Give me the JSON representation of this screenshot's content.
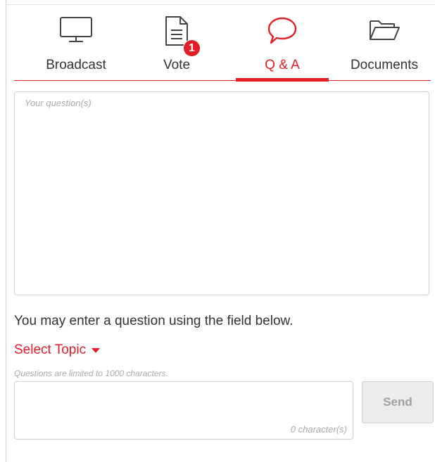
{
  "tabs": [
    {
      "label": "Broadcast",
      "icon": "monitor-icon",
      "active": false
    },
    {
      "label": "Vote",
      "icon": "document-icon",
      "active": false,
      "badge": "1"
    },
    {
      "label": "Q & A",
      "icon": "speech-bubble-icon",
      "active": true
    },
    {
      "label": "Documents",
      "icon": "folder-icon",
      "active": false
    }
  ],
  "qa": {
    "questions_placeholder": "Your question(s)",
    "intro": "You may enter a question using the field below.",
    "select_topic": "Select Topic",
    "limit_note": "Questions are limited to 1000 characters.",
    "char_count": "0 character(s)",
    "send_label": "Send"
  },
  "colors": {
    "accent": "#e41e26",
    "muted": "#aaaaaa",
    "button_bg": "#ececec"
  }
}
